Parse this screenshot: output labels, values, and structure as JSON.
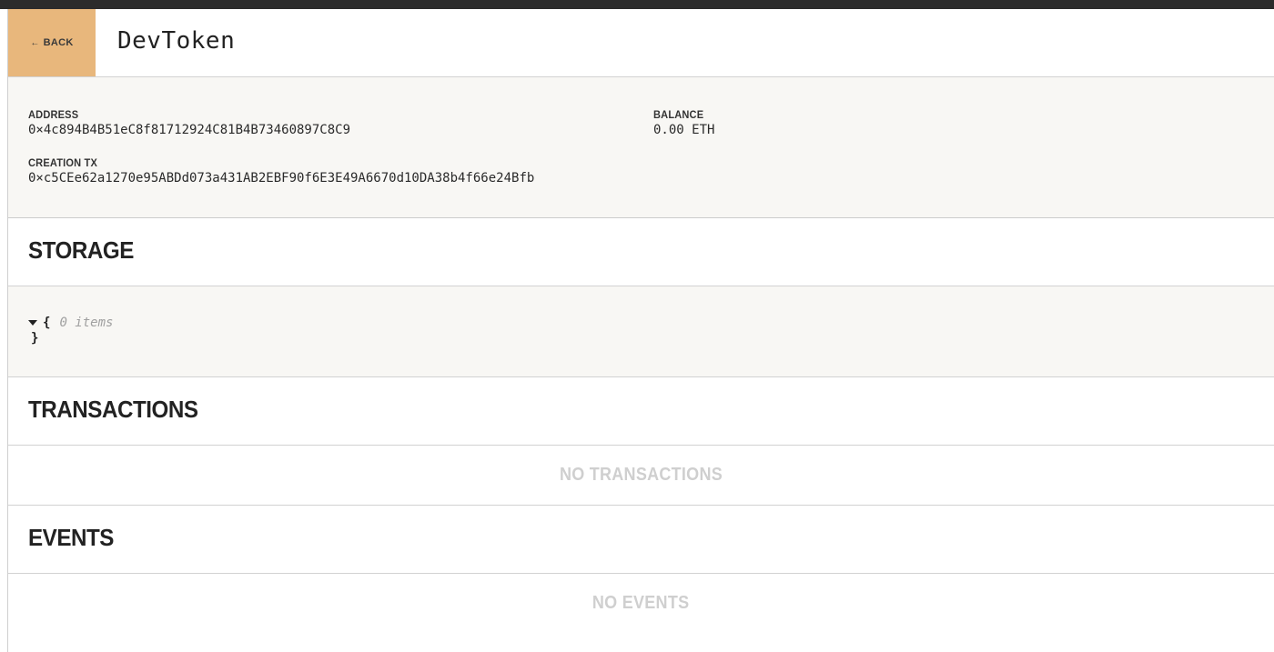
{
  "header": {
    "back_label": "BACK",
    "back_arrow": "←",
    "title": "DevToken"
  },
  "info": {
    "address_label": "ADDRESS",
    "address_value": "0×4c894B4B51eC8f81712924C81B4B73460897C8C9",
    "balance_label": "BALANCE",
    "balance_value": "0.00 ETH",
    "creation_tx_label": "CREATION TX",
    "creation_tx_value": "0×c5CEe62a1270e95ABDd073a431AB2EBF90f6E3E49A6670d10DA38b4f66e24Bfb"
  },
  "storage": {
    "title": "STORAGE",
    "open_brace": "{",
    "close_brace": "}",
    "item_count": "0 items"
  },
  "transactions": {
    "title": "TRANSACTIONS",
    "empty_text": "NO TRANSACTIONS"
  },
  "events": {
    "title": "EVENTS",
    "empty_text": "NO EVENTS"
  },
  "colors": {
    "back_button_bg": "#e8b77c",
    "panel_bg": "#f8f7f4",
    "empty_text": "#cfcfcf"
  }
}
